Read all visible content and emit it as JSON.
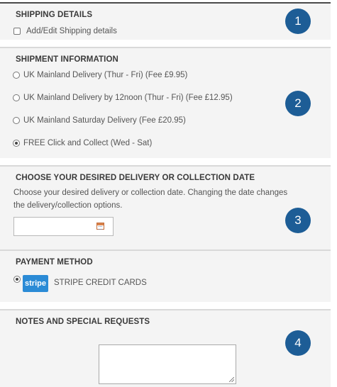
{
  "shipping_details": {
    "heading": "SHIPPING DETAILS",
    "checkbox_label": "Add/Edit Shipping details",
    "badge": "1"
  },
  "shipment_information": {
    "heading": "SHIPMENT INFORMATION",
    "badge": "2",
    "options": [
      {
        "label": "UK Mainland Delivery (Thur - Fri) (Fee £9.95)",
        "selected": false
      },
      {
        "label": "UK Mainland Delivery by 12noon (Thur - Fri) (Fee £12.95)",
        "selected": false
      },
      {
        "label": "UK Mainland Saturday Delivery (Fee £20.95)",
        "selected": false
      },
      {
        "label": "FREE Click and Collect (Wed - Sat)",
        "selected": true
      }
    ]
  },
  "delivery_date": {
    "heading": "CHOOSE YOUR DESIRED DELIVERY OR COLLECTION DATE",
    "description_line1": "Choose your desired delivery or collection date. Changing the date changes",
    "description_line2": "the delivery/collection options.",
    "badge": "3",
    "date_value": ""
  },
  "payment_method": {
    "heading": "PAYMENT METHOD",
    "logo_text": "stripe",
    "option_label": "STRIPE CREDIT CARDS",
    "selected": true
  },
  "notes": {
    "heading": "NOTES AND SPECIAL REQUESTS",
    "badge": "4",
    "value": ""
  },
  "colors": {
    "badge": "#1d5d96",
    "stripe": "#2b8bd6",
    "section_bg": "#f4f4f4"
  },
  "icons": {
    "calendar": "calendar-icon",
    "resize": "resize-grip-icon"
  }
}
